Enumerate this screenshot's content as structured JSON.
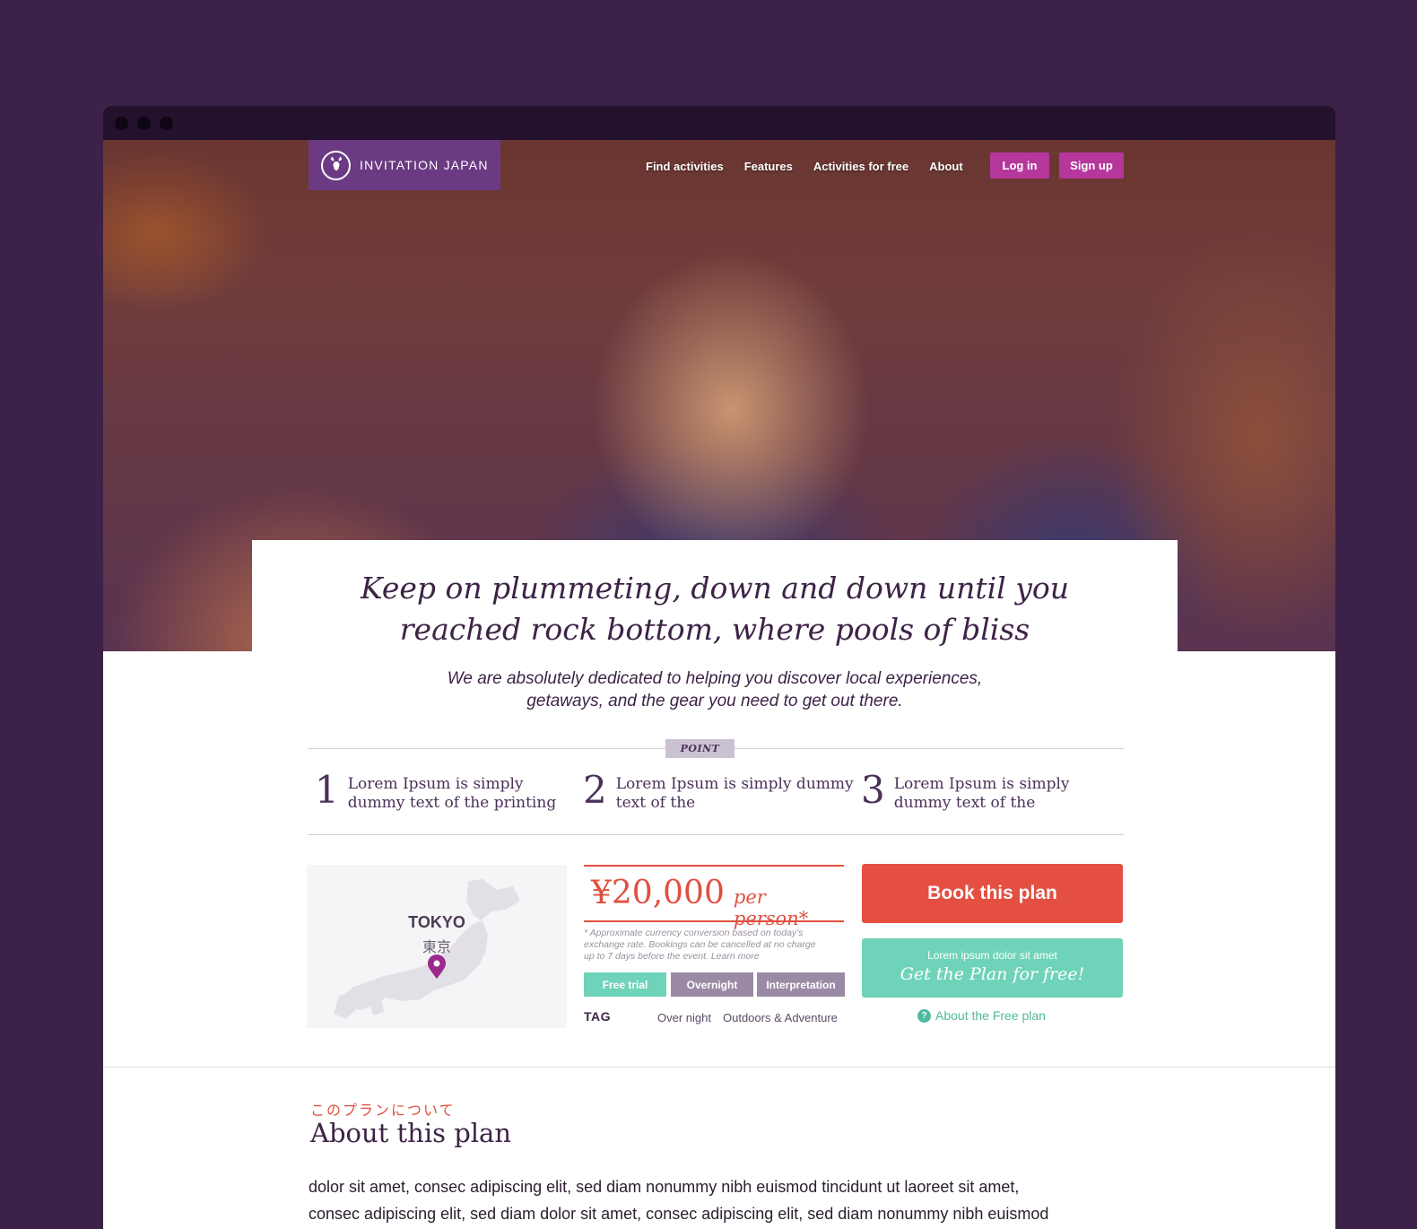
{
  "logo": {
    "text": "INVITATION JAPAN"
  },
  "nav": {
    "items": [
      "Find activities",
      "Features",
      "Activities for free",
      "About"
    ],
    "login": "Log in",
    "signup": "Sign up"
  },
  "hero": {
    "headline_line1": "Keep on plummeting, down and down until you",
    "headline_line2": "reached rock bottom, where pools of bliss",
    "sub_line1": "We are absolutely dedicated to helping you discover local experiences,",
    "sub_line2": "getaways, and the gear you need to get out there."
  },
  "points": {
    "label": "POINT",
    "items": [
      {
        "num": "1",
        "line1": "Lorem Ipsum is simply",
        "line2": "dummy text of the printing"
      },
      {
        "num": "2",
        "line1": "Lorem Ipsum is simply dummy",
        "line2": "text of the"
      },
      {
        "num": "3",
        "line1": "Lorem Ipsum is simply",
        "line2": "dummy text of the"
      }
    ]
  },
  "map": {
    "city": "TOKYO",
    "city_jp": "東京"
  },
  "price": {
    "amount": "¥20,000",
    "per": "per person*",
    "note_line1": "* Approximate currency conversion based on today’s",
    "note_line2": "exchange rate. Bookings can be cancelled at no charge",
    "note_line3": "up to 7 days before the event. Learn more"
  },
  "chips": [
    "Free trial",
    "Overnight",
    "Interpretation"
  ],
  "tags": {
    "label": "TAG",
    "items": [
      "Over night",
      "Outdoors & Adventure"
    ]
  },
  "actions": {
    "book": "Book this plan",
    "free_small": "Lorem ipsum dolor sit amet",
    "free_big": "Get the Plan for free!",
    "about_free": "About the Free plan",
    "q": "?"
  },
  "about": {
    "jp_title": "このプランについて",
    "title": "About this plan",
    "body_line1": "dolor sit amet, consec adipiscing elit, sed diam nonummy nibh euismod tincidunt ut laoreet sit amet,",
    "body_line2": "consec adipiscing elit, sed diam dolor sit amet, consec adipiscing elit, sed diam nonummy nibh euismod"
  },
  "colors": {
    "background": "#3c2148",
    "brand": "#6b3a82",
    "accent_pink": "#b5379b",
    "price_red": "#e0503f",
    "teal": "#6fd3b9"
  }
}
